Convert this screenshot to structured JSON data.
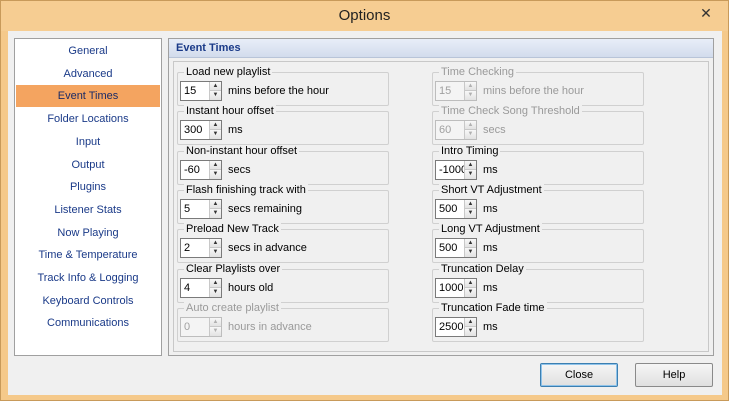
{
  "window": {
    "title": "Options",
    "close_glyph": "✕"
  },
  "sidebar": {
    "items": [
      {
        "label": "General",
        "active": false
      },
      {
        "label": "Advanced",
        "active": false
      },
      {
        "label": "Event Times",
        "active": true
      },
      {
        "label": "Folder Locations",
        "active": false
      },
      {
        "label": "Input",
        "active": false
      },
      {
        "label": "Output",
        "active": false
      },
      {
        "label": "Plugins",
        "active": false
      },
      {
        "label": "Listener Stats",
        "active": false
      },
      {
        "label": "Now Playing",
        "active": false
      },
      {
        "label": "Time & Temperature",
        "active": false
      },
      {
        "label": "Track Info & Logging",
        "active": false
      },
      {
        "label": "Keyboard Controls",
        "active": false
      },
      {
        "label": "Communications",
        "active": false
      }
    ]
  },
  "panel": {
    "title": "Event Times"
  },
  "left_fields": [
    {
      "label": "Load new playlist",
      "value": "15",
      "unit": "mins before the hour",
      "enabled": true
    },
    {
      "label": "Instant hour offset",
      "value": "300",
      "unit": "ms",
      "enabled": true
    },
    {
      "label": "Non-instant hour offset",
      "value": "-60",
      "unit": "secs",
      "enabled": true
    },
    {
      "label": "Flash finishing track with",
      "value": "5",
      "unit": "secs remaining",
      "enabled": true
    },
    {
      "label": "Preload New Track",
      "value": "2",
      "unit": "secs in advance",
      "enabled": true
    },
    {
      "label": "Clear Playlists over",
      "value": "4",
      "unit": "hours old",
      "enabled": true
    },
    {
      "label": "Auto create playlist",
      "value": "0",
      "unit": "hours in advance",
      "enabled": false
    }
  ],
  "right_fields": [
    {
      "label": "Time Checking",
      "value": "15",
      "unit": "mins before the hour",
      "enabled": false
    },
    {
      "label": "Time Check Song Threshold",
      "value": "60",
      "unit": "secs",
      "enabled": false
    },
    {
      "label": "Intro Timing",
      "value": "-1000",
      "unit": "ms",
      "enabled": true
    },
    {
      "label": "Short VT Adjustment",
      "value": "500",
      "unit": "ms",
      "enabled": true
    },
    {
      "label": "Long VT Adjustment",
      "value": "500",
      "unit": "ms",
      "enabled": true
    },
    {
      "label": "Truncation Delay",
      "value": "1000",
      "unit": "ms",
      "enabled": true
    },
    {
      "label": "Truncation Fade time",
      "value": "2500",
      "unit": "ms",
      "enabled": true
    }
  ],
  "buttons": {
    "close": "Close",
    "help": "Help"
  },
  "spinner": {
    "up": "▲",
    "down": "▼"
  },
  "colors": {
    "accent": "#f4a460",
    "title_bar": "#f6cd92",
    "nav_text": "#1a3a88"
  }
}
